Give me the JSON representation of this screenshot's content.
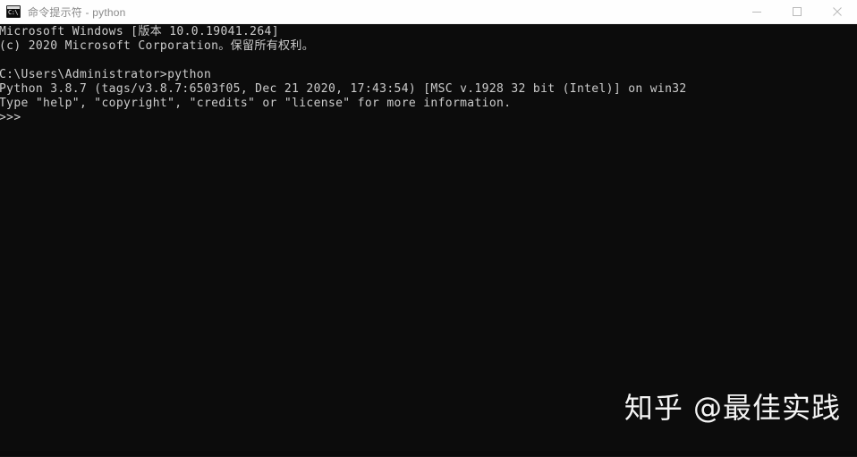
{
  "window": {
    "title": "命令提示符 - python",
    "icon": "cmd-icon",
    "icon_glyph": "C:\\",
    "titlebar_bg": "#fefefe",
    "title_color": "#8a8a8a",
    "console_bg": "#0c0c0c",
    "console_fg": "#cccccc"
  },
  "controls": {
    "minimize_label": "最小化",
    "maximize_label": "最大化",
    "close_label": "关闭"
  },
  "console": {
    "lines": [
      "Microsoft Windows [版本 10.0.19041.264]",
      "(c) 2020 Microsoft Corporation。保留所有权利。",
      "",
      "C:\\Users\\Administrator>python",
      "Python 3.8.7 (tags/v3.8.7:6503f05, Dec 21 2020, 17:43:54) [MSC v.1928 32 bit (Intel)] on win32",
      "Type \"help\", \"copyright\", \"credits\" or \"license\" for more information.",
      ">>>"
    ],
    "text": "Microsoft Windows [版本 10.0.19041.264]\n(c) 2020 Microsoft Corporation。保留所有权利。\n\nC:\\Users\\Administrator>python\nPython 3.8.7 (tags/v3.8.7:6503f05, Dec 21 2020, 17:43:54) [MSC v.1928 32 bit (Intel)] on win32\nType \"help\", \"copyright\", \"credits\" or \"license\" for more information.\n>>>",
    "prompt": ">>>",
    "working_directory": "C:\\Users\\Administrator",
    "command": "python",
    "python_version": "3.8.7",
    "os_build": "10.0.19041.264",
    "platform": "win32",
    "compiler": "MSC v.1928 32 bit (Intel)",
    "build_date": "Dec 21 2020, 17:43:54",
    "build_tag": "tags/v3.8.7:6503f05"
  },
  "watermark": {
    "text": "知乎 @最佳实践"
  }
}
